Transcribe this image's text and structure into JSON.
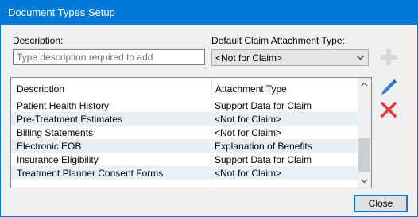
{
  "window": {
    "title": "Document Types Setup"
  },
  "form": {
    "description_label": "Description:",
    "description_placeholder": "Type description required to add",
    "description_value": "",
    "attachment_type_label": "Default Claim Attachment Type:",
    "attachment_type_value": "<Not for Claim>"
  },
  "grid": {
    "columns": [
      "Description",
      "Attachment Type"
    ],
    "rows": [
      {
        "description": "Patient Health History",
        "attachment_type": "Support Data for Claim"
      },
      {
        "description": "Pre-Treatment Estimates",
        "attachment_type": "<Not for Claim>"
      },
      {
        "description": "Billing Statements",
        "attachment_type": "<Not for Claim>"
      },
      {
        "description": "Electronic EOB",
        "attachment_type": "Explanation of Benefits"
      },
      {
        "description": "Insurance Eligibility",
        "attachment_type": "Support Data for Claim"
      },
      {
        "description": "Treatment Planner Consent Forms",
        "attachment_type": "<Not for Claim>"
      }
    ]
  },
  "icons": {
    "add": "plus-icon",
    "edit": "pencil-icon",
    "delete": "x-icon"
  },
  "colors": {
    "titlebar": "#0078d7",
    "alt_row": "#e6f0f6",
    "edit_icon": "#2f7fd6",
    "delete_icon": "#e53935",
    "add_icon_disabled": "#d6d6d6"
  },
  "buttons": {
    "close_label": "Close"
  }
}
